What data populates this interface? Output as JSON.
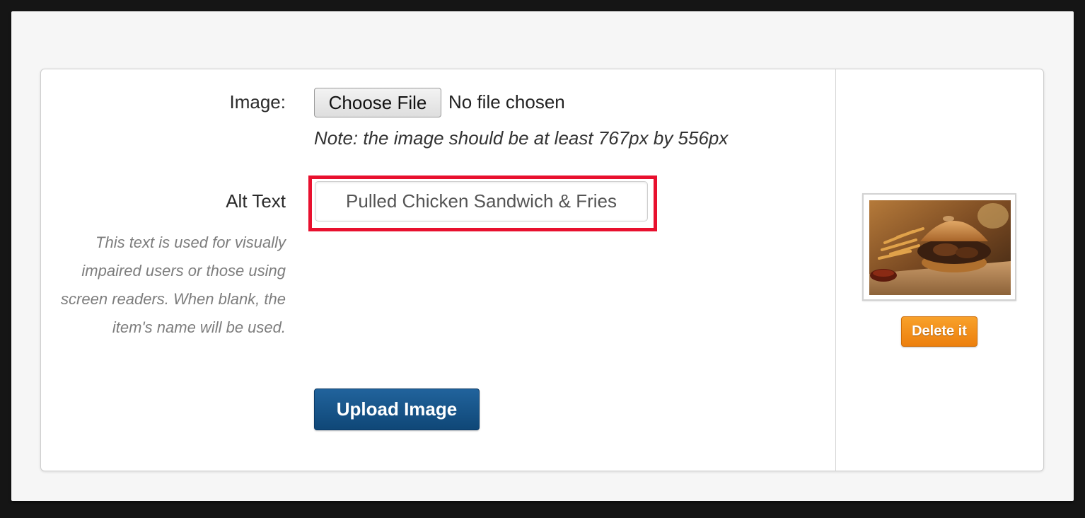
{
  "form": {
    "image_label": "Image:",
    "choose_file_label": "Choose File",
    "no_file_text": "No file chosen",
    "size_note": "Note: the image should be at least 767px by 556px",
    "alt_text_label": "Alt Text",
    "alt_text_help": "This text is used for visually impaired users or those using screen readers. When blank, the item's name will be used.",
    "alt_text_value": "Pulled Chicken Sandwich & Fries",
    "upload_button_label": "Upload Image"
  },
  "preview": {
    "image_subject": "pulled-chicken-sandwich-and-fries",
    "delete_button_label": "Delete it"
  },
  "colors": {
    "highlight": "#e8102e",
    "upload_button": "#15507f",
    "delete_button": "#f28a18"
  }
}
